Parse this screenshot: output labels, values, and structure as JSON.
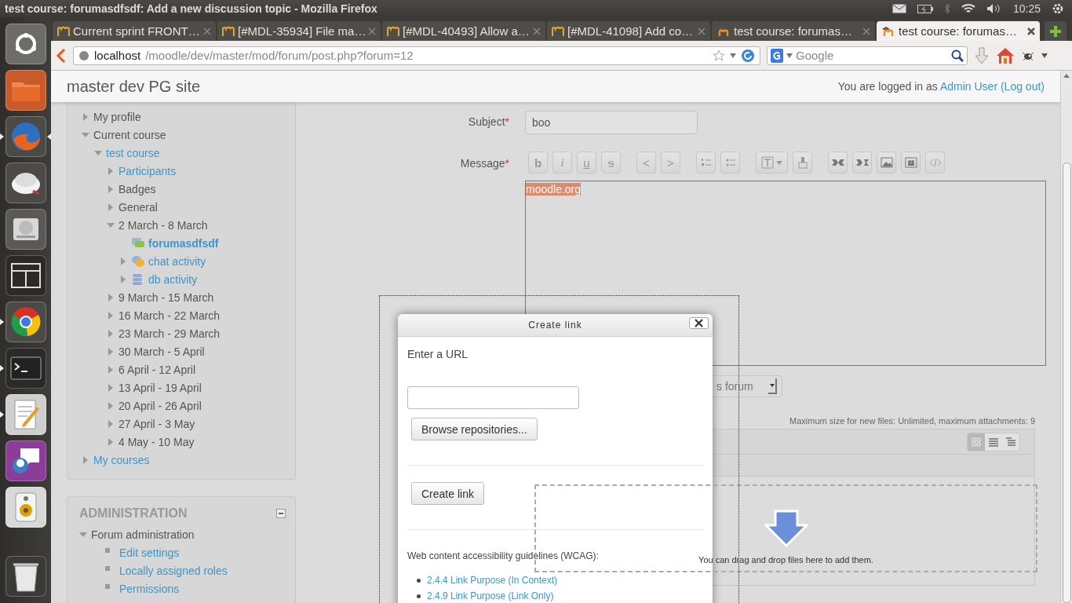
{
  "system_bar": {
    "title": "test course: forumasdfsdf: Add a new discussion topic - Mozilla Firefox",
    "time": "10:25"
  },
  "launcher": [
    {
      "kind": "dash",
      "running": false,
      "focused": false
    },
    {
      "kind": "files",
      "running": false,
      "focused": false
    },
    {
      "kind": "fox",
      "running": true,
      "focused": true
    },
    {
      "kind": "disc",
      "running": false,
      "focused": false
    },
    {
      "kind": "drive",
      "running": false,
      "focused": false
    },
    {
      "kind": "workspaces",
      "running": false,
      "focused": false
    },
    {
      "kind": "orb",
      "running": true,
      "focused": false
    },
    {
      "kind": "terminal",
      "running": true,
      "focused": false
    },
    {
      "kind": "editor",
      "running": true,
      "focused": false
    },
    {
      "kind": "chat",
      "running": false,
      "focused": false
    },
    {
      "kind": "speaker",
      "running": false,
      "focused": false
    },
    {
      "kind": "trash",
      "running": false,
      "focused": false
    }
  ],
  "tabs": [
    {
      "title": "Current sprint FRONT…",
      "kind": "classic",
      "selected": false
    },
    {
      "title": "[#MDL-35934] File ma…",
      "kind": "classic",
      "selected": false
    },
    {
      "title": "[#MDL-40493] Allow a…",
      "kind": "classic",
      "selected": false
    },
    {
      "title": "[#MDL-41098] Add co…",
      "kind": "classic",
      "selected": false
    },
    {
      "title": "test course: forumas…",
      "kind": "hat",
      "selected": false
    },
    {
      "title": "test course: forumas…",
      "kind": "hat",
      "selected": true
    }
  ],
  "navbar": {
    "host": "localhost",
    "path": "/moodle/dev/master/mod/forum/post.php?forum=12",
    "search_placeholder": "Google"
  },
  "header": {
    "site": "master dev PG site",
    "login_prefix": "You are logged in as",
    "user": "Admin User",
    "logout": "(Log out)"
  },
  "navigation": [
    {
      "label": "My profile",
      "kind": "branch",
      "link": false,
      "current": false,
      "expanded": false
    },
    {
      "label": "Current course",
      "kind": "branch",
      "link": false,
      "current": false,
      "expanded": true,
      "children": [
        {
          "label": "test course",
          "kind": "branch",
          "link": true,
          "current": false,
          "expanded": true,
          "children": [
            {
              "label": "Participants",
              "kind": "branch",
              "link": true,
              "current": false,
              "expanded": false
            },
            {
              "label": "Badges",
              "kind": "branch",
              "link": false,
              "current": false,
              "expanded": false
            },
            {
              "label": "General",
              "kind": "branch",
              "link": false,
              "current": false,
              "expanded": false
            },
            {
              "label": "2 March - 8 March",
              "kind": "branch",
              "link": false,
              "current": false,
              "expanded": true,
              "children": [
                {
                  "label": "forumasdfsdf",
                  "kind": "forum",
                  "link": true,
                  "current": true
                },
                {
                  "label": "chat activity",
                  "kind": "chat",
                  "link": true,
                  "current": false,
                  "expanded": false
                },
                {
                  "label": "db activity",
                  "kind": "db",
                  "link": true,
                  "current": false,
                  "expanded": false
                }
              ]
            },
            {
              "label": "9 March - 15 March",
              "kind": "branch",
              "link": false,
              "current": false,
              "expanded": false
            },
            {
              "label": "16 March - 22 March",
              "kind": "branch",
              "link": false,
              "current": false,
              "expanded": false
            },
            {
              "label": "23 March - 29 March",
              "kind": "branch",
              "link": false,
              "current": false,
              "expanded": false
            },
            {
              "label": "30 March - 5 April",
              "kind": "branch",
              "link": false,
              "current": false,
              "expanded": false
            },
            {
              "label": "6 April - 12 April",
              "kind": "branch",
              "link": false,
              "current": false,
              "expanded": false
            },
            {
              "label": "13 April - 19 April",
              "kind": "branch",
              "link": false,
              "current": false,
              "expanded": false
            },
            {
              "label": "20 April - 26 April",
              "kind": "branch",
              "link": false,
              "current": false,
              "expanded": false
            },
            {
              "label": "27 April - 3 May",
              "kind": "branch",
              "link": false,
              "current": false,
              "expanded": false
            },
            {
              "label": "4 May - 10 May",
              "kind": "branch",
              "link": false,
              "current": false,
              "expanded": false
            }
          ]
        }
      ]
    },
    {
      "label": "My courses",
      "kind": "branch",
      "link": true,
      "current": false,
      "expanded": false
    }
  ],
  "administration": {
    "title": "ADMINISTRATION",
    "items": [
      {
        "label": "Forum administration",
        "kind": "branch",
        "link": false,
        "current": false,
        "expanded": true,
        "children": [
          {
            "label": "Edit settings",
            "kind": "leaf",
            "link": true,
            "current": false
          },
          {
            "label": "Locally assigned roles",
            "kind": "leaf",
            "link": true,
            "current": false
          },
          {
            "label": "Permissions",
            "kind": "leaf",
            "link": true,
            "current": false
          }
        ]
      }
    ]
  },
  "form": {
    "required_mark": "*",
    "subject": {
      "label": "Subject",
      "value": "boo"
    },
    "message": {
      "label": "Message",
      "toolbar": [
        [
          {
            "kind": "bold",
            "glyph": "b"
          },
          {
            "kind": "italic",
            "glyph": "i"
          },
          {
            "kind": "underline",
            "glyph": "u"
          },
          {
            "kind": "strike",
            "glyph": "s"
          }
        ],
        [
          {
            "kind": "outdent",
            "glyph": "<"
          },
          {
            "kind": "indent",
            "glyph": ">"
          }
        ],
        [
          {
            "kind": "ordered"
          },
          {
            "kind": "unordered"
          }
        ],
        [
          {
            "kind": "style"
          },
          {
            "kind": "clear"
          }
        ],
        [
          {
            "kind": "link"
          },
          {
            "kind": "unlink"
          },
          {
            "kind": "image"
          },
          {
            "kind": "media"
          },
          {
            "kind": "html"
          }
        ]
      ],
      "content": "moodle.org",
      "content_selected": true
    },
    "select_value": "s forum",
    "max_size_note": "Maximum size for new files: Unlimited, maximum attachments: 9",
    "view_buttons": [
      {
        "kind": "icons",
        "selected": true
      },
      {
        "kind": "list",
        "selected": false
      },
      {
        "kind": "tree",
        "selected": false
      }
    ],
    "drop_hint": "You can drag and drop files here to add them."
  },
  "dialog": {
    "title": "Create link",
    "url_label": "Enter a URL",
    "browse": "Browse repositories...",
    "create": "Create link",
    "wcag_heading": "Web content accessibility guidelines (WCAG):",
    "wcag_links": [
      "2.4.4 Link Purpose (In Context)",
      "2.4.9 Link Purpose (Link Only)"
    ]
  }
}
